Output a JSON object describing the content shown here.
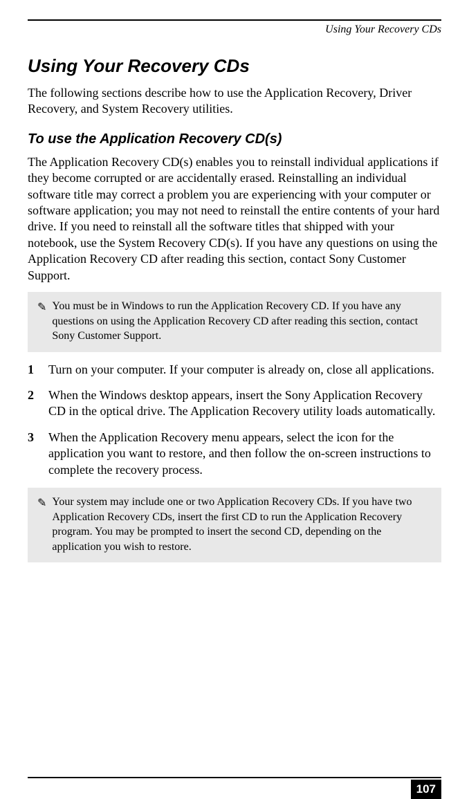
{
  "header": {
    "running_title": "Using Your Recovery CDs"
  },
  "main": {
    "title": "Using Your Recovery CDs",
    "intro": "The following sections describe how to use the Application Recovery, Driver Recovery, and System Recovery utilities.",
    "subtitle": "To use the Application Recovery CD(s)",
    "body": "The Application Recovery CD(s) enables you to reinstall individual applications if they become corrupted or are accidentally erased. Reinstalling an individual software title may correct a problem you are experiencing with your computer or software application; you may not need to reinstall the entire contents of your hard drive. If you need to reinstall all the software titles that shipped with your notebook, use the System Recovery CD(s). If you have any questions on using the Application Recovery CD after reading this section, contact Sony Customer Support.",
    "note1": {
      "icon": "✎",
      "text": "You must be in Windows to run the Application Recovery CD. If you have any questions on using the Application Recovery CD after reading this section, contact Sony Customer Support."
    },
    "steps": [
      {
        "num": "1",
        "text": "Turn on your computer. If your computer is already on, close all applications."
      },
      {
        "num": "2",
        "text": "When the Windows desktop appears, insert the Sony Application Recovery CD in the optical drive. The Application Recovery utility loads automatically."
      },
      {
        "num": "3",
        "text": "When the Application Recovery menu appears, select the icon for the application you want to restore, and then follow the on-screen instructions to complete the recovery process."
      }
    ],
    "note2": {
      "icon": "✎",
      "text": "Your system may include one or two Application Recovery CDs. If you have two Application Recovery CDs, insert the first CD to run the Application Recovery program. You may be prompted to insert the second CD, depending on the application you wish to restore."
    }
  },
  "footer": {
    "page_number": "107"
  }
}
